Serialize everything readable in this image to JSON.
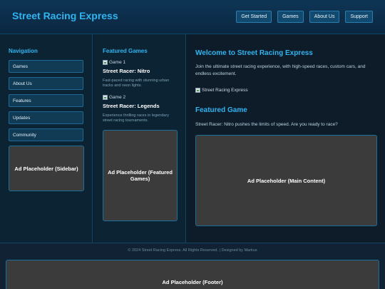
{
  "header": {
    "title": "Street Racing Express",
    "nav": [
      "Get Started",
      "Games",
      "About Us",
      "Support"
    ]
  },
  "sidebar": {
    "heading": "Navigation",
    "items": [
      "Games",
      "About Us",
      "Features",
      "Updates",
      "Community"
    ],
    "ad": "Ad Placeholder (Sidebar)"
  },
  "featured": {
    "heading": "Featured Games",
    "games": [
      {
        "img_alt": "Game 1",
        "title": "Street Racer: Nitro",
        "desc": "Fast-paced racing with stunning urban tracks and neon lights."
      },
      {
        "img_alt": "Game 2",
        "title": "Street Racer: Legends",
        "desc": "Experience thrilling races in legendary street racing tournaments."
      }
    ],
    "ad": "Ad Placeholder (Featured Games)"
  },
  "main": {
    "welcome_heading": "Welcome to Street Racing Express",
    "welcome_text": "Join the ultimate street racing experience, with high-speed races, custom cars, and endless excitement.",
    "img_alt": "Street Racing Express",
    "featured_heading": "Featured Game",
    "featured_text": "Street Racer: Nitro pushes the limits of speed. Are you ready to race?",
    "ad": "Ad Placeholder (Main Content)"
  },
  "footer": {
    "text": "© 2024 Street Racing Express. All Rights Reserved. | Designed by Markus",
    "ad": "Ad Placeholder (Footer)"
  },
  "colors": {
    "accent": "#2fb4f0",
    "background": "#0b1a26",
    "ad_background": "#3b3b3b"
  }
}
